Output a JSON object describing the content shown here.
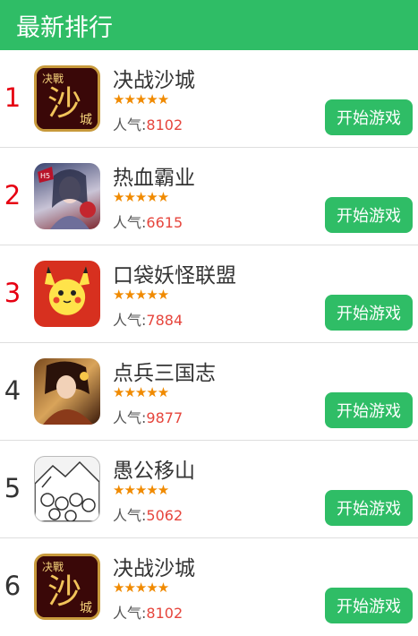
{
  "header": {
    "title": "最新排行"
  },
  "items": [
    {
      "rank": "1",
      "name": "决战沙城",
      "stars": "★★★★★",
      "pop_label": "人气:",
      "pop_value": "8102",
      "button": "开始游戏",
      "icon": "jue-zhan-sha-cheng-icon",
      "icon_text": "沙",
      "icon_small": "决戰",
      "icon_corner": "城"
    },
    {
      "rank": "2",
      "name": "热血霸业",
      "stars": "★★★★★",
      "pop_label": "人气:",
      "pop_value": "6615",
      "button": "开始游戏",
      "icon": "re-xue-ba-ye-icon",
      "icon_badge": "H5"
    },
    {
      "rank": "3",
      "name": "口袋妖怪联盟",
      "stars": "★★★★★",
      "pop_label": "人气:",
      "pop_value": "7884",
      "button": "开始游戏",
      "icon": "kou-dai-yao-guai-icon"
    },
    {
      "rank": "4",
      "name": "点兵三国志",
      "stars": "★★★★★",
      "pop_label": "人气:",
      "pop_value": "9877",
      "button": "开始游戏",
      "icon": "dian-bing-san-guo-zhi-icon"
    },
    {
      "rank": "5",
      "name": "愚公移山",
      "stars": "★★★★★",
      "pop_label": "人气:",
      "pop_value": "5062",
      "button": "开始游戏",
      "icon": "yu-gong-yi-shan-icon"
    },
    {
      "rank": "6",
      "name": "决战沙城",
      "stars": "★★★★★",
      "pop_label": "人气:",
      "pop_value": "8102",
      "button": "开始游戏",
      "icon": "jue-zhan-sha-cheng-icon",
      "icon_text": "沙",
      "icon_small": "决戰",
      "icon_corner": "城"
    }
  ]
}
